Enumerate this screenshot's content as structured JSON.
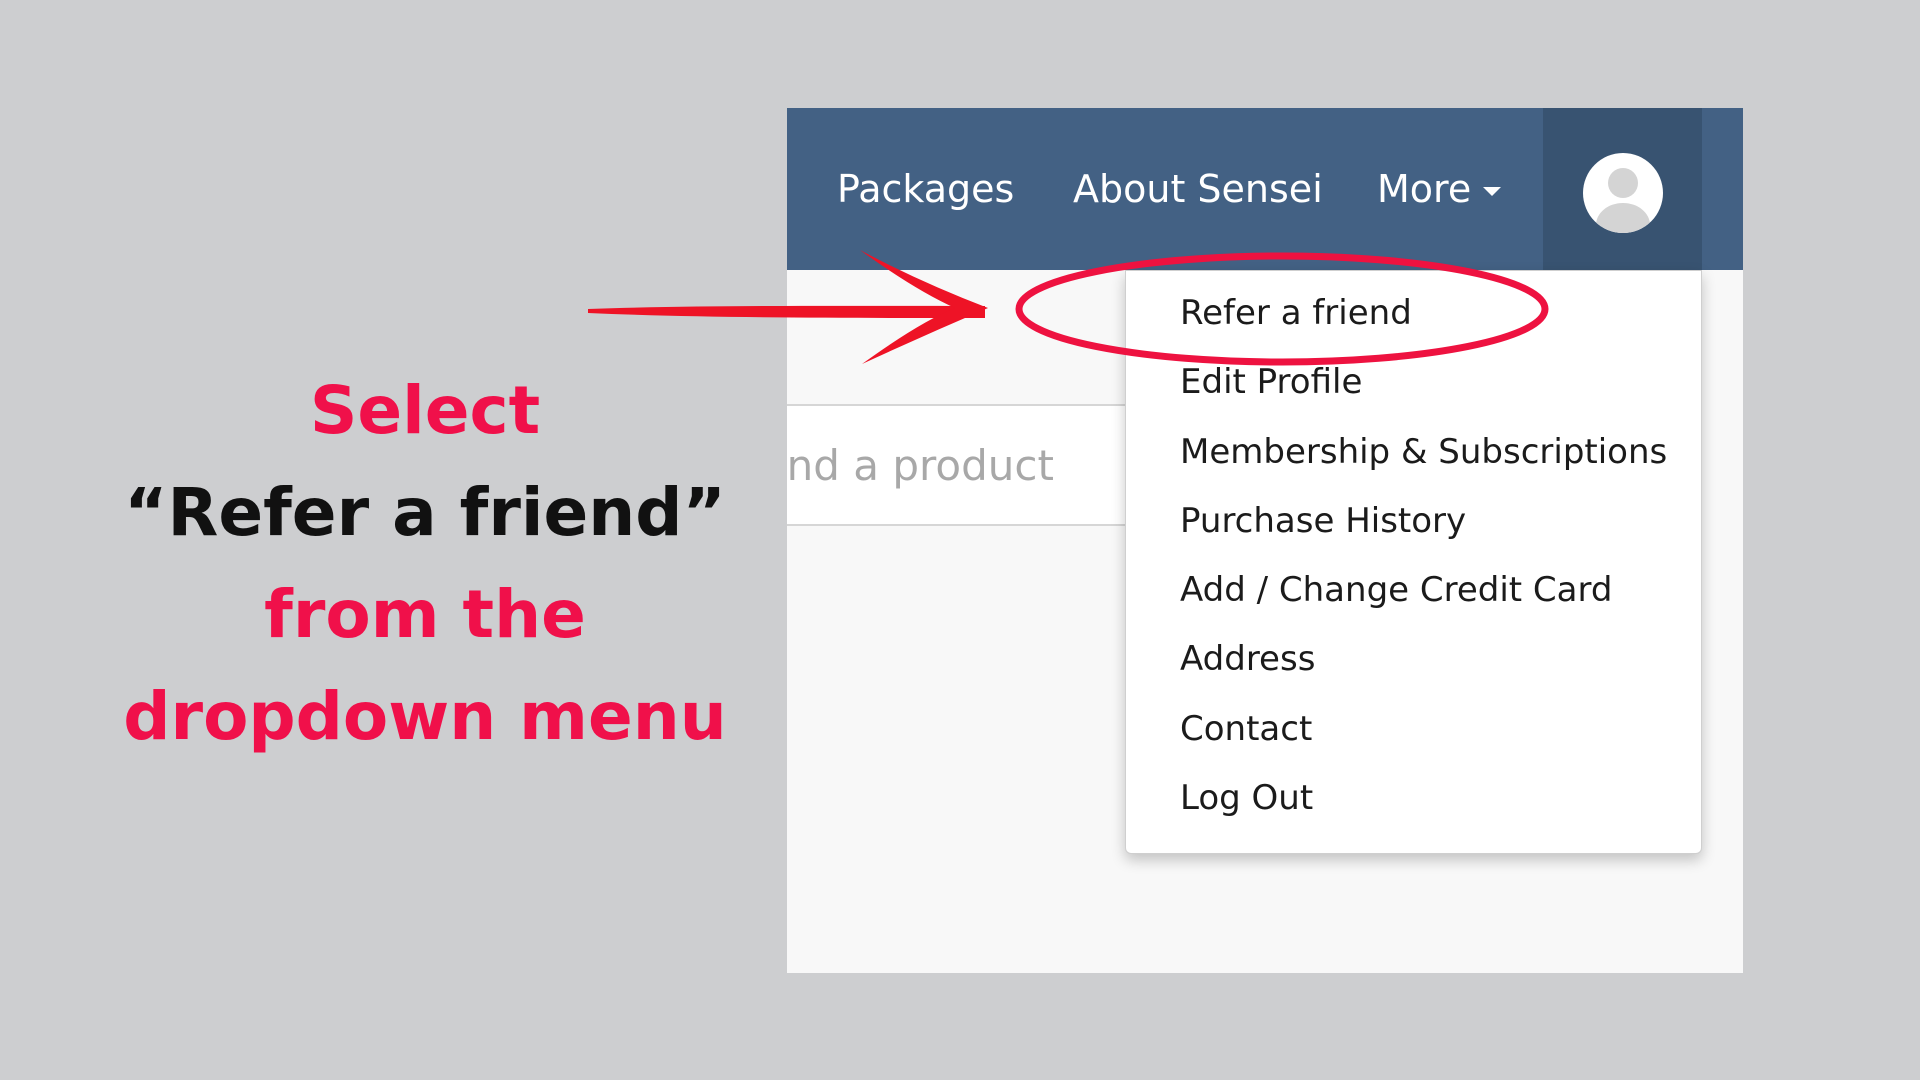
{
  "instruction": {
    "line1": "Select",
    "line2": "“Refer a friend”",
    "line3": "from the",
    "line4": "dropdown menu"
  },
  "navbar": {
    "items": [
      {
        "label": "Packages"
      },
      {
        "label": "About Sensei"
      },
      {
        "label": "More"
      }
    ],
    "avatar_icon": "user-avatar-icon"
  },
  "search": {
    "placeholder": "ind a product"
  },
  "dropdown": {
    "items": [
      {
        "label": "Refer a friend"
      },
      {
        "label": "Edit Profile"
      },
      {
        "label": "Membership & Subscriptions"
      },
      {
        "label": "Purchase History"
      },
      {
        "label": "Add / Change Credit Card"
      },
      {
        "label": "Address"
      },
      {
        "label": "Contact"
      },
      {
        "label": "Log Out"
      }
    ]
  },
  "colors": {
    "background": "#cdced0",
    "navbar": "#436184",
    "avatar_cell": "#385371",
    "annotation_red": "#f0104a"
  }
}
